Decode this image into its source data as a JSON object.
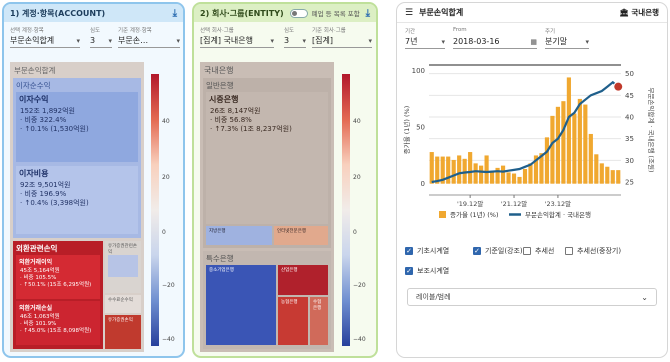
{
  "panel1": {
    "title": "1) 계정·항목(ACCOUNT)",
    "download_icon": "download-icon",
    "controls": [
      {
        "label": "선택 계정·항목",
        "value": "부문손익합계"
      },
      {
        "label": "심도",
        "value": "3"
      },
      {
        "label": "기준 계정·항목",
        "value": "부문손…"
      }
    ],
    "treemap": {
      "root": "부문손익합계",
      "interest": "이자순수익",
      "income_title": "이자수익",
      "income_value": "152조 1,892억원",
      "income_share": "· 비중 322.4%",
      "income_change": "· ↑0.1% (1,530억원)",
      "expense_title": "이자비용",
      "expense_value": "92조 9,501억원",
      "expense_share": "· 비중 196.9%",
      "expense_change": "· ↑0.4% (3,398억원)",
      "fx_title": "외환관련손익",
      "fx_a_title": "외환거래이익",
      "fx_a_value": "45조 5,164억원",
      "fx_a_share": "· 비중 105.5%",
      "fx_a_change": "· ↑50.1% (15조 6,295억원)",
      "fx_b_title": "외환거래손실",
      "fx_b_value": "46조 1,063억원",
      "fx_b_share": "· 비중 101.9%",
      "fx_b_change": "· ↑45.0% (15조 8,098억원)",
      "s1": "유가증권관련손익",
      "s2": "수수료순수익",
      "s3": "유가증권손익"
    },
    "scale_ticks": [
      "40",
      "20",
      "0",
      "−20",
      "−40"
    ]
  },
  "panel2": {
    "title": "2) 회사·그룹(ENTITY)",
    "toggle_label": "폐업 등 목록 포함",
    "download_icon": "download-icon",
    "controls": [
      {
        "label": "선택 회사·그룹",
        "value": "[집계] 국내은행"
      },
      {
        "label": "심도",
        "value": "3"
      },
      {
        "label": "기준 회사·그룹",
        "value": "[집계]"
      }
    ],
    "treemap": {
      "root": "국내은행",
      "general": "일반은행",
      "city_title": "시중은행",
      "city_value": "26조 8,147억원",
      "city_share": "· 비중 56.8%",
      "city_change": "· ↑7.3% (1조 8,237억원)",
      "local": "지방은행",
      "internet": "인터넷전문은행",
      "special": "특수은행",
      "sp1": "중소기업은행",
      "sp2": "산업은행",
      "sp3": "농협은행",
      "sp4": "수협은행"
    },
    "scale_ticks": [
      "40",
      "20",
      "0",
      "−20",
      "−40"
    ]
  },
  "panel3": {
    "title": "부문손익합계",
    "menu_icon": "filter-icon",
    "bank_label": "국내은행",
    "bank_icon": "bank-icon",
    "period_label": "기간",
    "period_value": "7년",
    "from_label": "From",
    "from_value": "2018-03-16",
    "freq_label": "주기",
    "freq_value": "분기말",
    "checkboxes": [
      {
        "label": "기초시계열",
        "checked": true
      },
      {
        "label": "기준일(강조)",
        "checked": true
      },
      {
        "label": "추세선",
        "checked": false
      },
      {
        "label": "추세선(중장기)",
        "checked": false
      },
      {
        "label": "보조시계열",
        "checked": true
      }
    ],
    "dropdown_label": "레이블/범례"
  },
  "colors": {
    "bar": "#f0a830",
    "line": "#1f5f8b",
    "marker": "#c0392b",
    "blue_cell": "#8fa8df",
    "red_cell": "#c8202a",
    "grey_cell": "#c7bcb5"
  },
  "chart_data": {
    "type": "bar",
    "title": "",
    "xlabel": "",
    "x_ticks": [
      "'19.12말",
      "'21.12말",
      "'23.12말"
    ],
    "y_left_label": "증가율 (1년) (%)",
    "y_left_ticks": [
      "100",
      "50",
      "0"
    ],
    "y_left_range": [
      -10,
      105
    ],
    "y_right_label": "부문손익합계 · 국내은행 (조원)",
    "y_right_ticks": [
      "50",
      "45",
      "40",
      "35",
      "30",
      "25"
    ],
    "y_right_range": [
      22,
      52
    ],
    "grid": true,
    "legend_position": "bottom",
    "series": [
      {
        "name": "증가율 (1년) (%)",
        "type": "bar",
        "axis": "left",
        "values": [
          28,
          24,
          24,
          24,
          21,
          25,
          22,
          28,
          18,
          16,
          25,
          10,
          14,
          16,
          10,
          9,
          6,
          13,
          18,
          25,
          27,
          41,
          60,
          68,
          73,
          94,
          62,
          75,
          70,
          44,
          26,
          18,
          15,
          12,
          12
        ]
      },
      {
        "name": "부문손익합계 · 국내은행",
        "type": "line",
        "axis": "right",
        "values": [
          25,
          25.2,
          25.5,
          26,
          26.5,
          27,
          27.2,
          27.3,
          27.5,
          27.4,
          27.3,
          27.4,
          27.5,
          27.4,
          27.6,
          27.8,
          28,
          28.5,
          29,
          30,
          31,
          32,
          34,
          35,
          37,
          40,
          41,
          43,
          44,
          45,
          45.5,
          46,
          47,
          48,
          47
        ]
      }
    ]
  }
}
